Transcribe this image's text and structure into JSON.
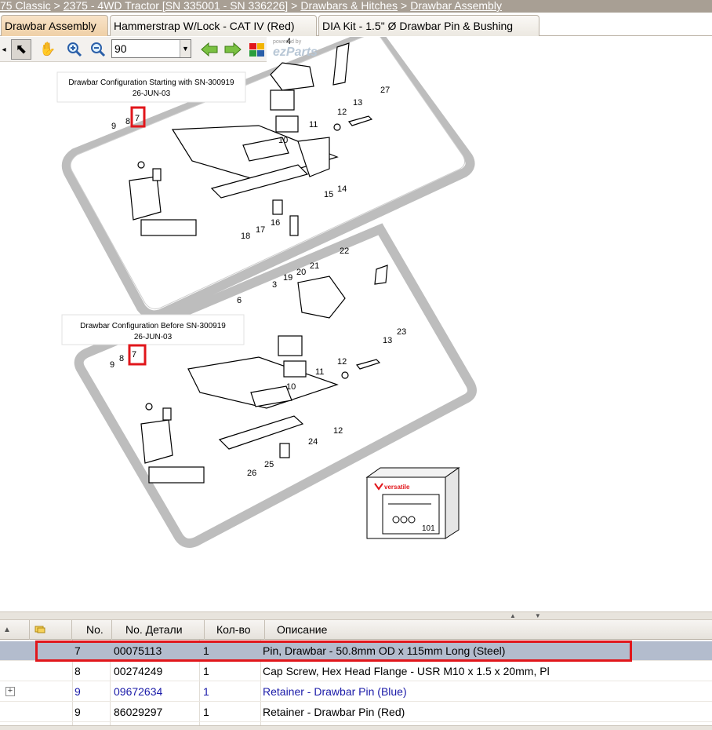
{
  "breadcrumb": {
    "items": [
      "75 Classic",
      "2375 - 4WD Tractor [SN 335001 - SN 336226]",
      "Drawbars & Hitches",
      "Drawbar Assembly"
    ],
    "separator": ">"
  },
  "tabs": [
    {
      "label": "Drawbar Assembly",
      "active": true
    },
    {
      "label": "Hammerstrap W/Lock - CAT IV (Red)",
      "active": false
    },
    {
      "label": "DIA Kit - 1.5\" Ø Drawbar Pin & Bushing",
      "active": false
    }
  ],
  "toolbar": {
    "zoom_value": "90",
    "tools": [
      "select-arrow-icon",
      "pan-hand-icon",
      "zoom-in-icon",
      "zoom-out-icon",
      "previous-arrow-icon",
      "next-arrow-icon"
    ],
    "powered_by": "powered by",
    "brand": "ezParts"
  },
  "diagram": {
    "top_caption": {
      "line1": "Drawbar Configuration Starting with SN-300919",
      "line2": "26-JUN-03"
    },
    "bottom_caption": {
      "line1": "Drawbar Configuration Before SN-300919",
      "line2": "26-JUN-03"
    },
    "top_callouts": [
      "4",
      "27",
      "12",
      "13",
      "11",
      "10",
      "9",
      "8",
      "7",
      "14",
      "15",
      "16",
      "17",
      "18"
    ],
    "bottom_callouts": [
      "22",
      "21",
      "20",
      "19",
      "3",
      "6",
      "23",
      "13",
      "12",
      "11",
      "10",
      "9",
      "8",
      "7",
      "12",
      "24",
      "25",
      "26"
    ],
    "kit_box": {
      "brand": "versatile",
      "number": "101"
    },
    "colors": {
      "highlight": "#e1161b",
      "line": "#000000",
      "shadow": "#bdbdbd"
    }
  },
  "table": {
    "columns": [
      "No.",
      "No. Детали",
      "Кол-во",
      "Описание"
    ],
    "rows": [
      {
        "no": "7",
        "part": "00075113",
        "qty": "1",
        "desc": "Pin, Drawbar - 50.8mm OD x 115mm Long (Steel)",
        "selected": true,
        "expandable": false,
        "blue": false
      },
      {
        "no": "8",
        "part": "00274249",
        "qty": "1",
        "desc": "Cap Screw, Hex Head Flange - USR M10 x 1.5 x 20mm, Pl",
        "selected": false,
        "expandable": false,
        "blue": false
      },
      {
        "no": "9",
        "part": "09672634",
        "qty": "1",
        "desc": "Retainer - Drawbar Pin (Blue)",
        "selected": false,
        "expandable": true,
        "blue": true
      },
      {
        "no": "9",
        "part": "86029297",
        "qty": "1",
        "desc": "Retainer - Drawbar Pin (Red)",
        "selected": false,
        "expandable": false,
        "blue": false
      }
    ]
  }
}
